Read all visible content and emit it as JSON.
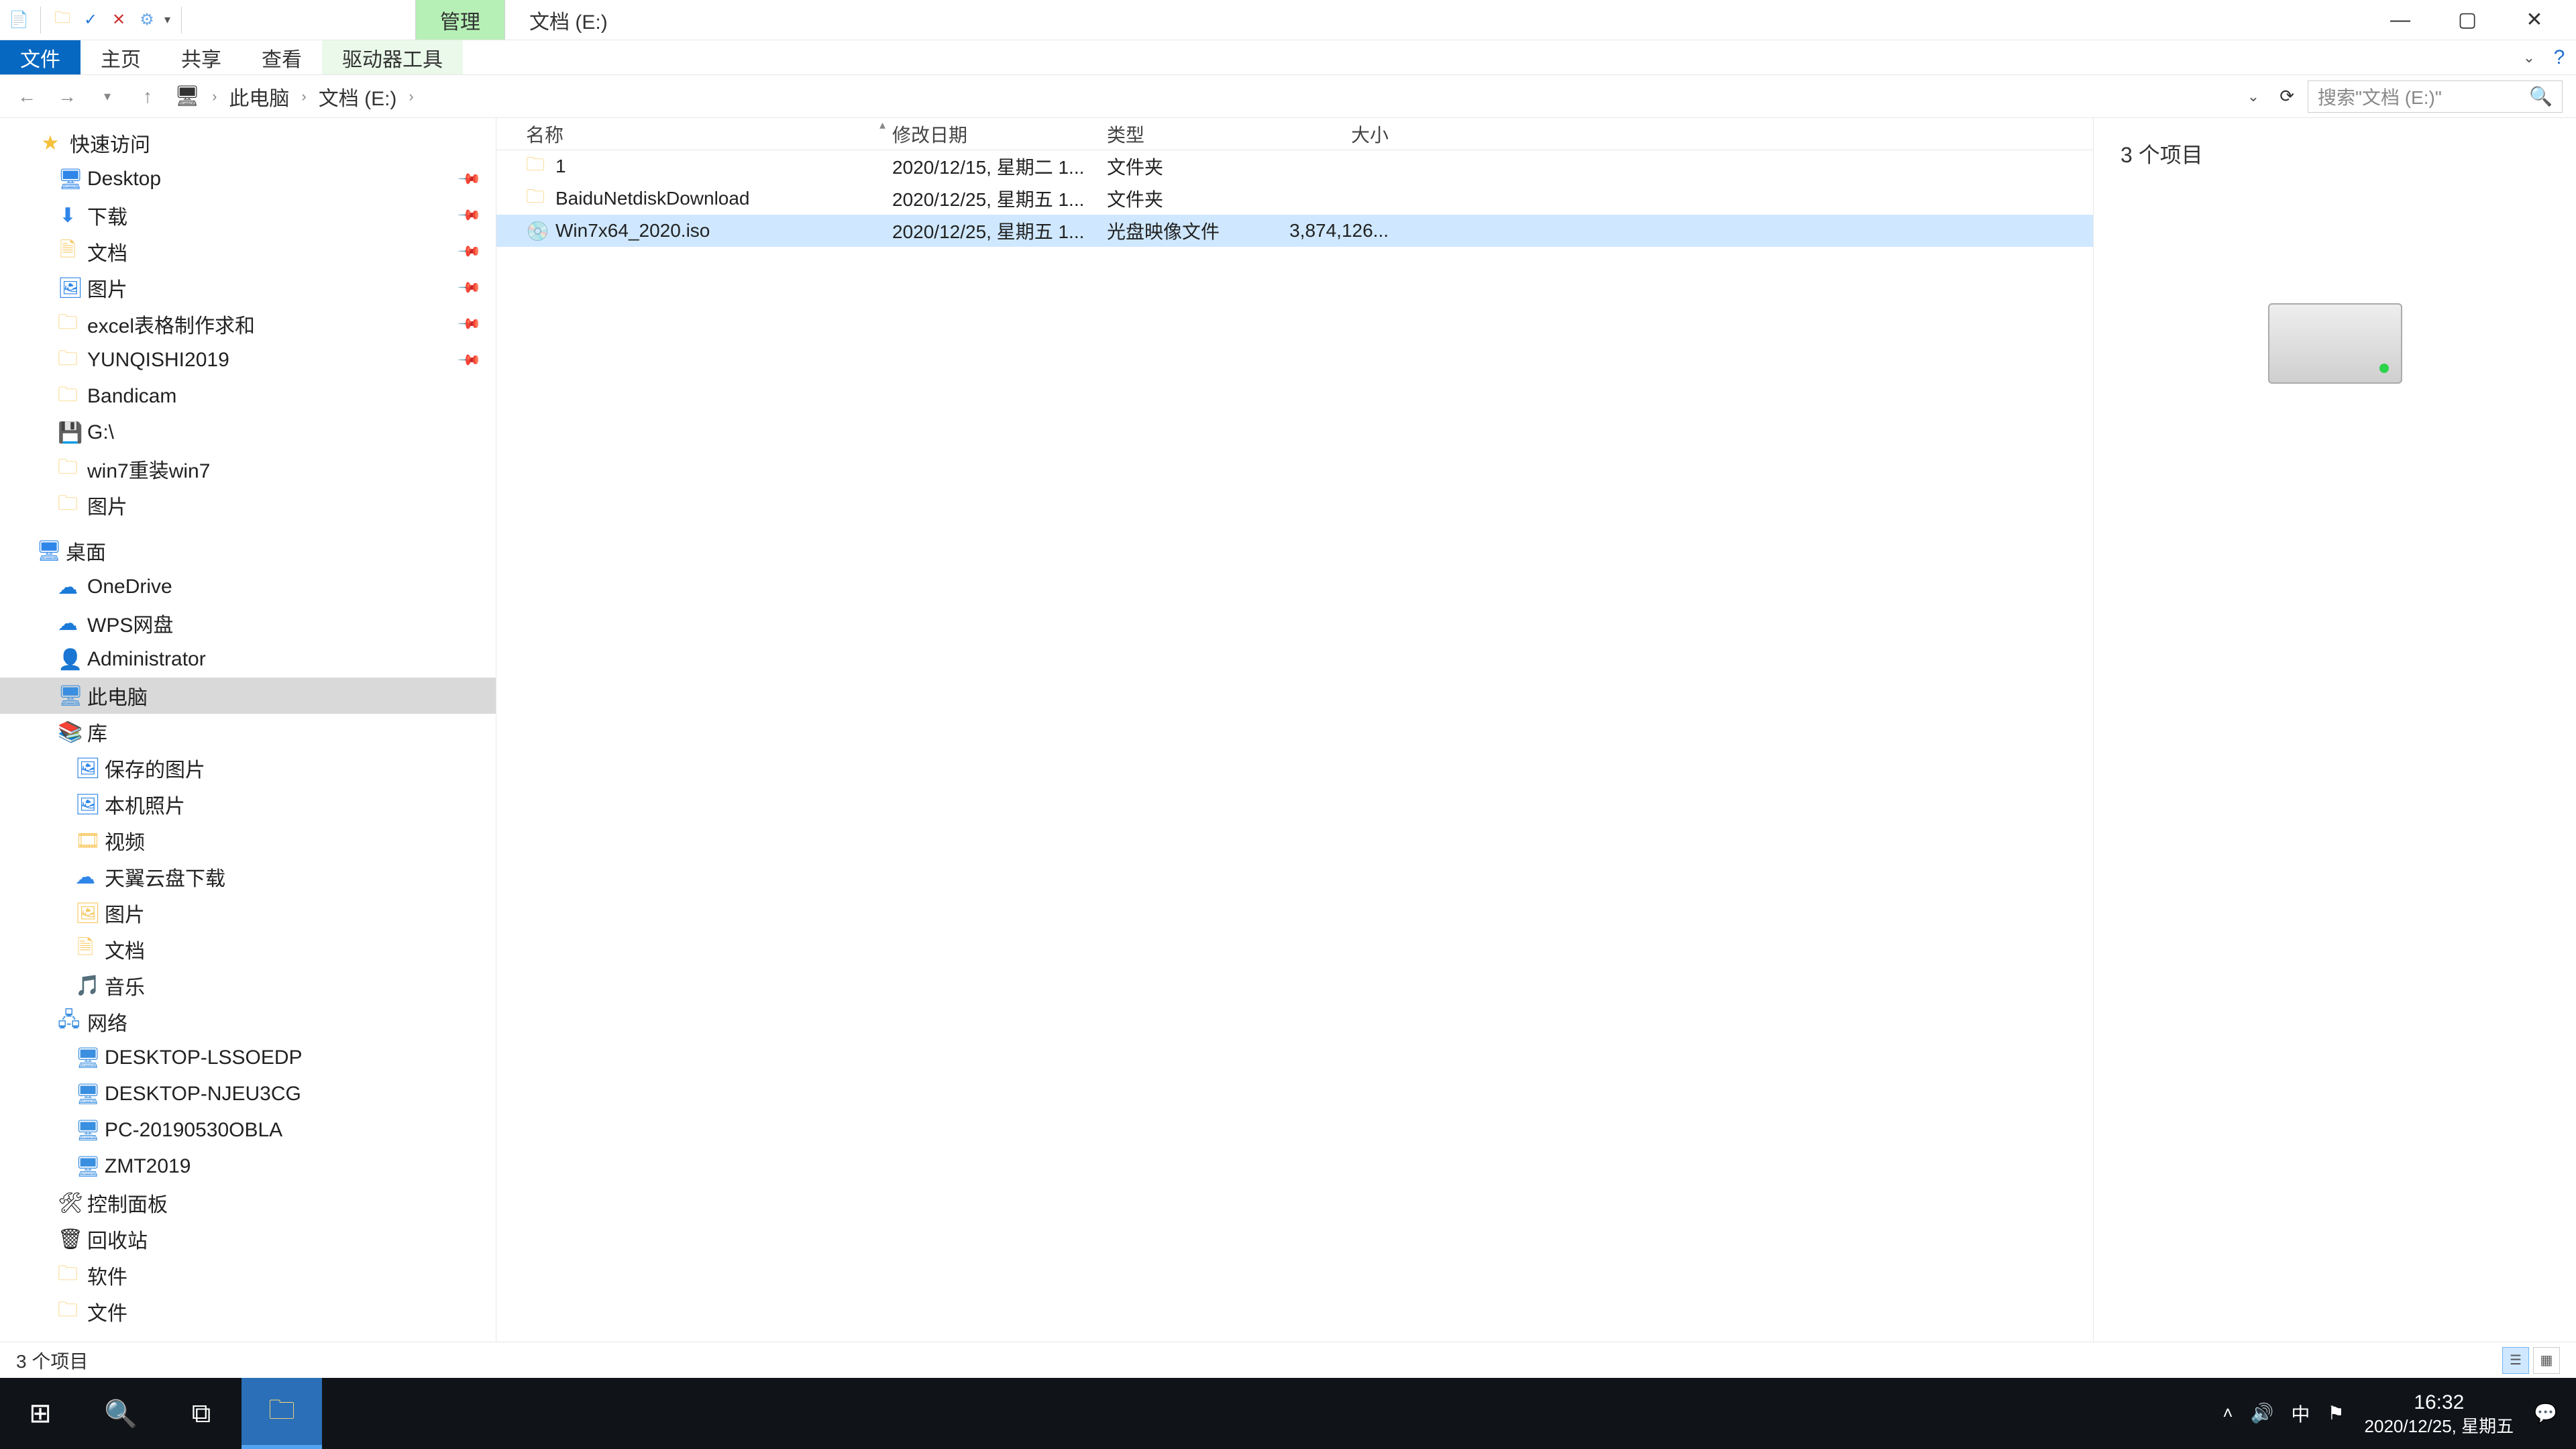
{
  "title_context_tab": "管理",
  "title_location": "文档 (E:)",
  "win_min": "—",
  "win_max": "▢",
  "win_close": "✕",
  "ribbon": {
    "file": "文件",
    "home": "主页",
    "share": "共享",
    "view": "查看",
    "tools": "驱动器工具"
  },
  "breadcrumb": {
    "root": "此电脑",
    "loc": "文档 (E:)"
  },
  "search_placeholder": "搜索\"文档 (E:)\"",
  "columns": {
    "name": "名称",
    "date": "修改日期",
    "type": "类型",
    "size": "大小"
  },
  "files": [
    {
      "name": "1",
      "date": "2020/12/15, 星期二 1...",
      "type": "文件夹",
      "size": "",
      "icon": "folder"
    },
    {
      "name": "BaiduNetdiskDownload",
      "date": "2020/12/25, 星期五 1...",
      "type": "文件夹",
      "size": "",
      "icon": "folder"
    },
    {
      "name": "Win7x64_2020.iso",
      "date": "2020/12/25, 星期五 1...",
      "type": "光盘映像文件",
      "size": "3,874,126...",
      "icon": "iso",
      "selected": true
    }
  ],
  "nav": {
    "quick": "快速访问",
    "quick_items": [
      "Desktop",
      "下载",
      "文档",
      "图片",
      "excel表格制作求和",
      "YUNQISHI2019",
      "Bandicam",
      "G:\\",
      "win7重装win7",
      "图片"
    ],
    "desktop": "桌面",
    "desktop_items": [
      "OneDrive",
      "WPS网盘",
      "Administrator",
      "此电脑",
      "库"
    ],
    "lib_items": [
      "保存的图片",
      "本机照片",
      "视频",
      "天翼云盘下载",
      "图片",
      "文档",
      "音乐"
    ],
    "network": "网络",
    "net_items": [
      "DESKTOP-LSSOEDP",
      "DESKTOP-NJEU3CG",
      "PC-20190530OBLA",
      "ZMT2019"
    ],
    "cp": "控制面板",
    "recycle": "回收站",
    "soft": "软件",
    "docs": "文件"
  },
  "preview_count": "3 个项目",
  "status": "3 个项目",
  "taskbar": {
    "time": "16:32",
    "date": "2020/12/25, 星期五",
    "ime": "中"
  }
}
